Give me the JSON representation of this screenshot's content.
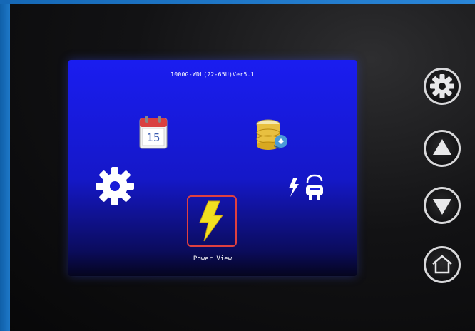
{
  "device": {
    "title": "1000G-WDL(22-65U)Ver5.1",
    "selected_label": "Power View"
  },
  "menu_icons": [
    {
      "name": "calendar-icon",
      "day": "15"
    },
    {
      "name": "database-icon"
    },
    {
      "name": "settings-icon"
    },
    {
      "name": "power-connection-icon"
    },
    {
      "name": "power-view-icon"
    }
  ],
  "side_buttons": [
    {
      "name": "settings-button",
      "icon": "gear-icon"
    },
    {
      "name": "up-button",
      "icon": "triangle-up-icon"
    },
    {
      "name": "down-button",
      "icon": "triangle-down-icon"
    },
    {
      "name": "home-button",
      "icon": "home-icon"
    }
  ],
  "colors": {
    "screen_blue": "#1a1df0",
    "selection_border": "#e04040",
    "bezel_blue": "#1e78c8"
  }
}
